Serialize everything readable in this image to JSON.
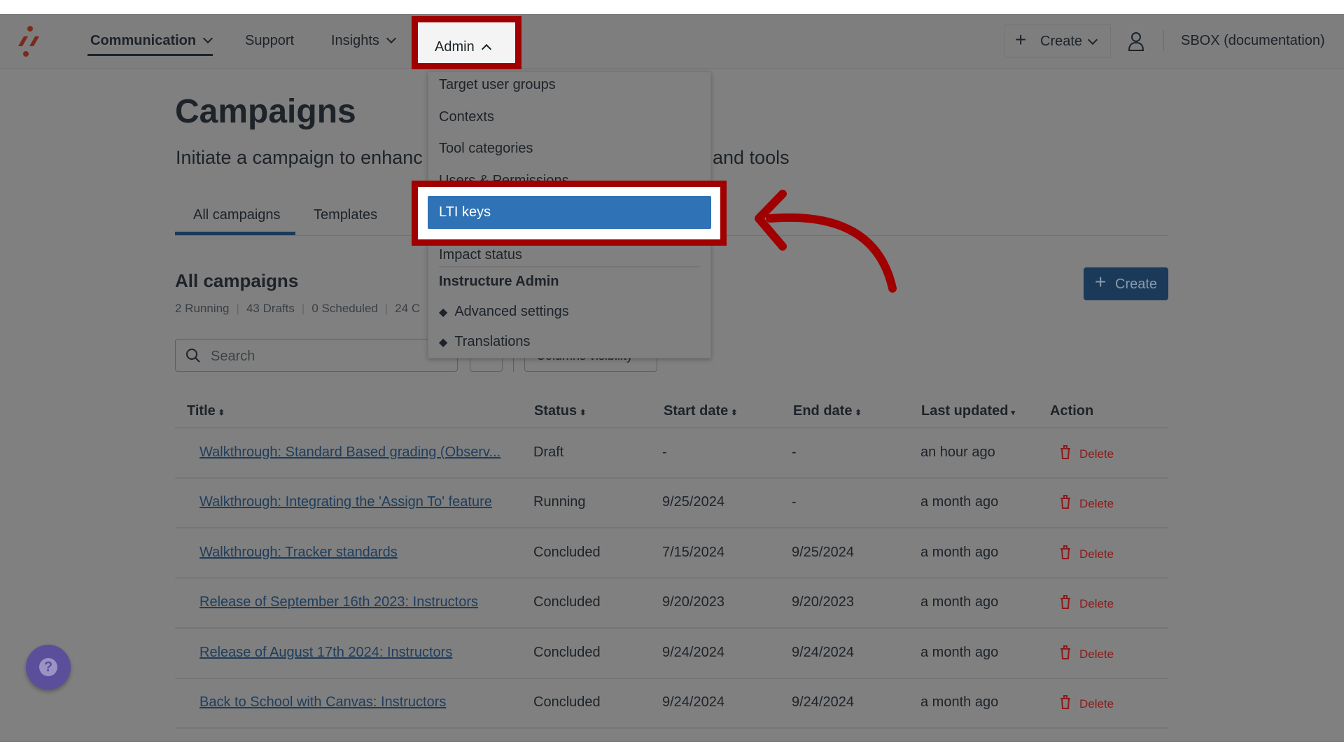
{
  "nav": {
    "items": [
      {
        "label": "Communication",
        "has_chevron": true,
        "active": true
      },
      {
        "label": "Support"
      },
      {
        "label": "Insights",
        "has_chevron": true
      },
      {
        "label": "Admin",
        "has_chevron": true,
        "open": true
      }
    ],
    "create_label": "Create",
    "account_label": "SBOX (documentation)"
  },
  "admin_menu": {
    "items": [
      "Target user groups",
      "Contexts",
      "Tool categories",
      "Users & Permissions",
      "LTI keys",
      "Impact status"
    ],
    "highlighted": "LTI keys",
    "section_heading": "Instructure Admin",
    "section_items": [
      "Advanced settings",
      "Translations"
    ]
  },
  "page": {
    "title": "Campaigns",
    "subtitle_start": "Initiate a campaign to enhanc",
    "subtitle_end": "and tools",
    "tabs": [
      "All campaigns",
      "Templates"
    ],
    "active_tab": "All campaigns",
    "section_title": "All campaigns",
    "stats": [
      "2 Running",
      "43 Drafts",
      "0 Scheduled",
      "24 C"
    ],
    "create_label": "Create",
    "search_placeholder": "Search",
    "columns_visibility_label": "Columns visibility"
  },
  "table": {
    "columns": [
      "Title",
      "Status",
      "Start date",
      "End date",
      "Last updated",
      "Action"
    ],
    "rows": [
      {
        "title": "Walkthrough: Standard Based grading (Observ...",
        "status": "Draft",
        "start": "-",
        "end": "-",
        "updated": "an hour ago",
        "action": "Delete"
      },
      {
        "title": "Walkthrough: Integrating the 'Assign To' feature",
        "status": "Running",
        "start": "9/25/2024",
        "end": "-",
        "updated": "a month ago",
        "action": "Delete"
      },
      {
        "title": "Walkthrough: Tracker standards",
        "status": "Concluded",
        "start": "7/15/2024",
        "end": "9/25/2024",
        "updated": "a month ago",
        "action": "Delete"
      },
      {
        "title": "Release of September 16th 2023: Instructors",
        "status": "Concluded",
        "start": "9/20/2023",
        "end": "9/20/2023",
        "updated": "a month ago",
        "action": "Delete"
      },
      {
        "title": "Release of August 17th 2024: Instructors",
        "status": "Concluded",
        "start": "9/24/2024",
        "end": "9/24/2024",
        "updated": "a month ago",
        "action": "Delete"
      },
      {
        "title": "Back to School with Canvas: Instructors",
        "status": "Concluded",
        "start": "9/24/2024",
        "end": "9/24/2024",
        "updated": "a month ago",
        "action": "Delete"
      }
    ]
  },
  "colors": {
    "annotation": "#a00000",
    "highlight": "#2f72b5",
    "primary_button": "#1b3a5a",
    "delete": "#8c1a1a",
    "help": "#5b4e9a"
  }
}
